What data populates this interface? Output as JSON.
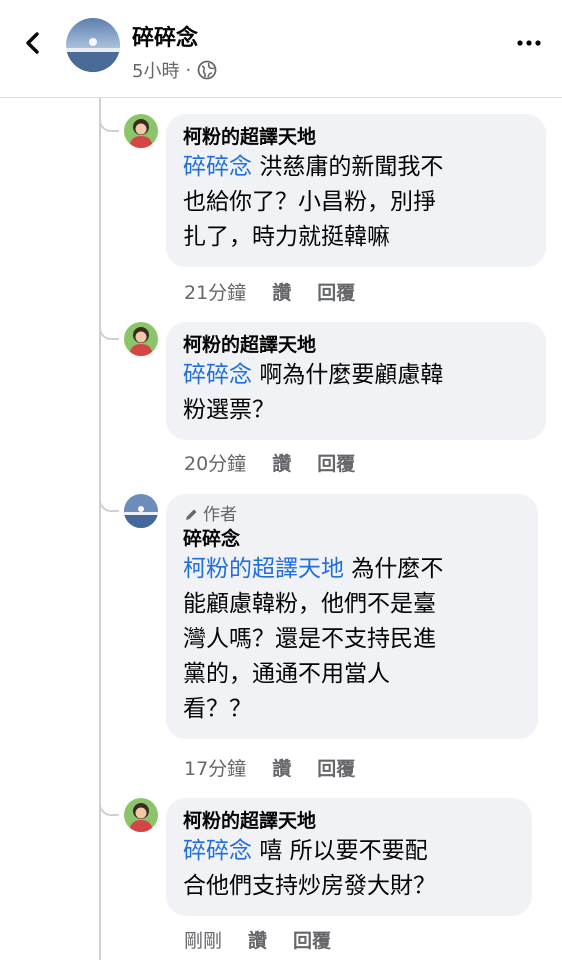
{
  "header": {
    "name": "碎碎念",
    "time": "5小時",
    "dot": "·",
    "privacy_icon": "globe-icon",
    "back_icon": "chevron-left-icon",
    "more_icon": "more-horizontal-icon"
  },
  "comments": [
    {
      "author": "柯粉的超譯天地",
      "mention": "碎碎念",
      "text_lines": [
        "洪慈庸的新聞我不",
        "也給你了？小昌粉，別掙",
        "扎了，時力就挺韓嘛"
      ],
      "time": "21分鐘",
      "like": "讚",
      "reply": "回覆"
    },
    {
      "author": "柯粉的超譯天地",
      "mention": "碎碎念",
      "text_lines": [
        "啊為什麼要顧慮韓",
        "粉選票？"
      ],
      "time": "20分鐘",
      "like": "讚",
      "reply": "回覆"
    },
    {
      "author_tag": "作者",
      "author": "碎碎念",
      "mention": "柯粉的超譯天地",
      "text_lines": [
        "為什麼不",
        "能顧慮韓粉，他們不是臺",
        "灣人嗎？還是不支持民進",
        "黨的，通通不用當人",
        "看？？"
      ],
      "time": "17分鐘",
      "like": "讚",
      "reply": "回覆"
    },
    {
      "author": "柯粉的超譯天地",
      "mention": "碎碎念",
      "text_lines": [
        "嘻 所以要不要配",
        "合他們支持炒房發大財？"
      ],
      "time": "剛剛",
      "like": "讚",
      "reply": "回覆"
    }
  ],
  "colors": {
    "mention": "#216fdb",
    "bubble": "#f0f2f5",
    "secondary_text": "#65676b"
  }
}
